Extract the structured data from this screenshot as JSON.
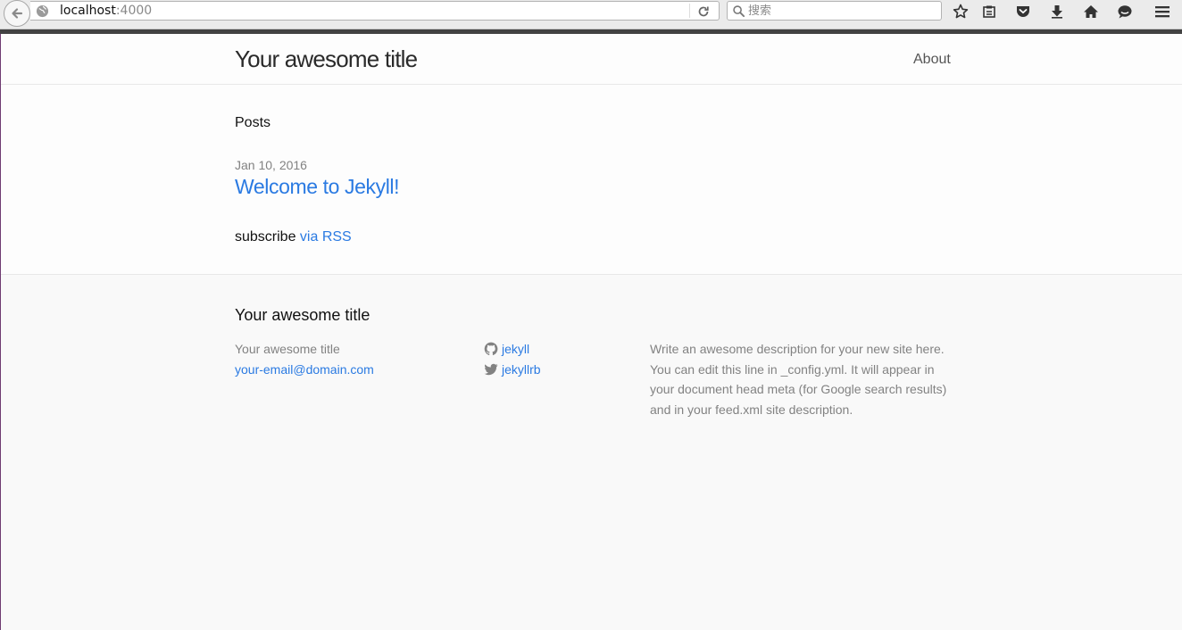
{
  "browser": {
    "url_host": "localhost",
    "url_port": ":4000",
    "search_placeholder": "搜索"
  },
  "header": {
    "site_title": "Your awesome title",
    "nav": [
      {
        "label": "About"
      }
    ]
  },
  "main": {
    "heading": "Posts",
    "posts": [
      {
        "date": "Jan 10, 2016",
        "title": "Welcome to Jekyll!"
      }
    ],
    "rss_prefix": "subscribe ",
    "rss_link": "via RSS"
  },
  "footer": {
    "heading": "Your awesome title",
    "name": "Your awesome title",
    "email": "your-email@domain.com",
    "social": [
      {
        "icon": "github-icon",
        "username": "jekyll"
      },
      {
        "icon": "twitter-icon",
        "username": "jekyllrb"
      }
    ],
    "description": "Write an awesome description for your new site here. You can edit this line in _config.yml. It will appear in your document head meta (for Google search results) and in your feed.xml site description."
  },
  "colors": {
    "link": "#2a7ae2",
    "text": "#111111",
    "muted": "#828282",
    "footer_bg": "#f9f9f9"
  }
}
